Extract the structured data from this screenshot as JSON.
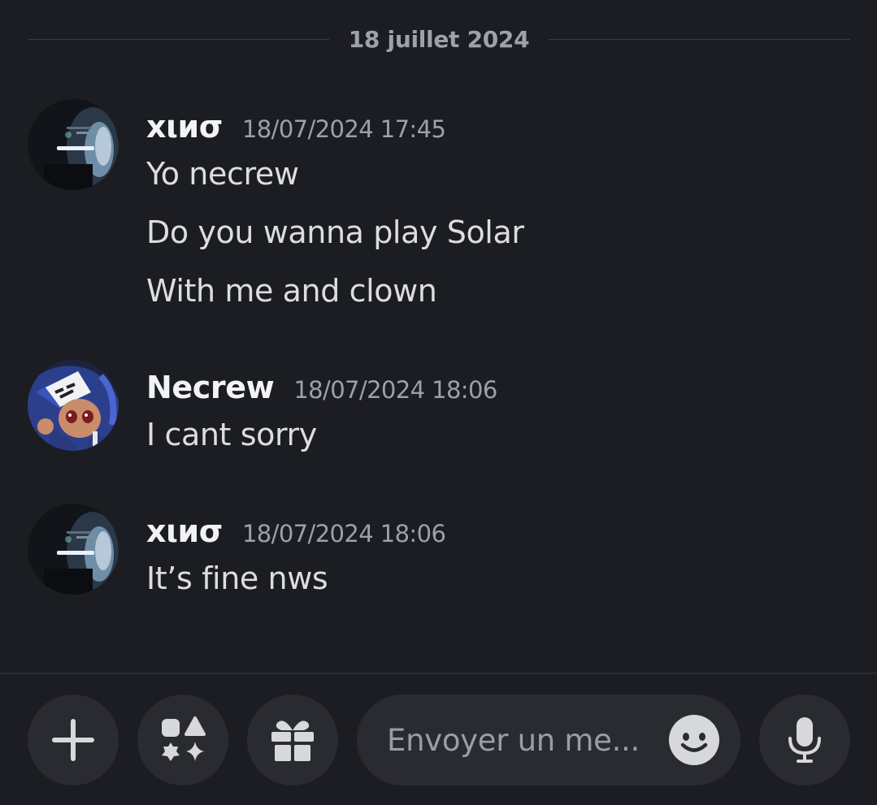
{
  "date_divider": "18 juillet 2024",
  "messages": [
    {
      "username": "xιиσ",
      "timestamp": "18/07/2024 17:45",
      "lines": [
        "Yo necrew",
        "Do you wanna play Solar",
        "With me and clown"
      ]
    },
    {
      "username": "Necrew",
      "timestamp": "18/07/2024 18:06",
      "lines": [
        "I cant sorry"
      ]
    },
    {
      "username": "xιиσ",
      "timestamp": "18/07/2024 18:06",
      "lines": [
        "It’s fine nws"
      ]
    }
  ],
  "composer": {
    "placeholder": "Envoyer un me...",
    "buttons": [
      "plus-icon",
      "apps-icon",
      "gift-icon",
      "microphone-icon"
    ],
    "emoji_icon": "smiley-icon"
  },
  "colors": {
    "background": "#1c1d22",
    "button_bg": "#2a2b31",
    "username": "#f2f3f5",
    "message_text": "#dcdde1",
    "muted_text": "#9ea0a8"
  }
}
